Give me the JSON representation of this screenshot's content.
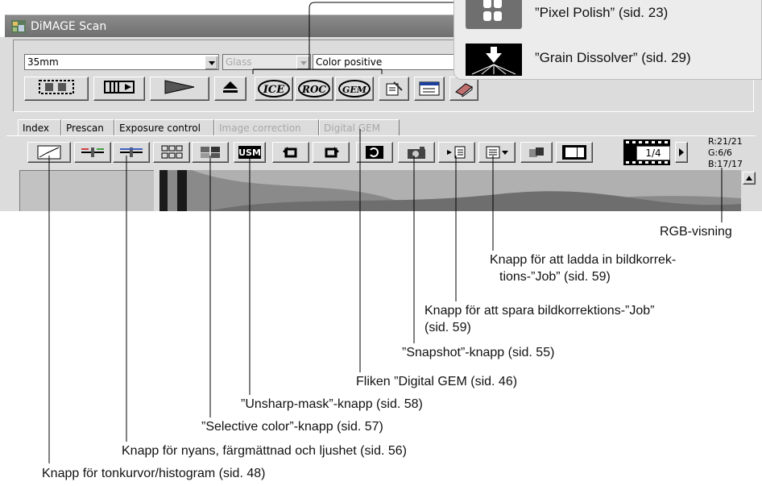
{
  "window": {
    "title": "DiMAGE Scan",
    "film_format": "35mm",
    "holder": "Glass",
    "film_type": "Color positive"
  },
  "top_toolbar": {
    "buttons": [
      "index-scan",
      "prescan",
      "scan",
      "eject",
      "ice",
      "roc",
      "gem",
      "preferences",
      "settings",
      "help"
    ],
    "ice_label": "ICE",
    "roc_label": "ROC",
    "gem_label": "GEM"
  },
  "tabs": [
    {
      "label": "Index",
      "enabled": true
    },
    {
      "label": "Prescan",
      "enabled": true
    },
    {
      "label": "Exposure control",
      "enabled": true
    },
    {
      "label": "Image correction",
      "enabled": false
    },
    {
      "label": "Digital GEM",
      "enabled": false
    }
  ],
  "correction_toolbar": {
    "frame_counter": "1/4",
    "rgb_r": "R:21/21",
    "rgb_g": "G:6/6",
    "rgb_b": "B:17/17"
  },
  "callout": {
    "pixel_polish": "”Pixel Polish” (sid. 23)",
    "grain_dissolver": "”Grain Dissolver” (sid. 29)"
  },
  "annotations": {
    "rgb_display": "RGB-visning",
    "load_job_line1": "Knapp för att ladda in bildkorrek-",
    "load_job_line2": "tions-”Job” (sid. 59)",
    "save_job_line1": "Knapp för att spara bildkorrektions-”Job”",
    "save_job_line2": "(sid. 59)",
    "snapshot": "”Snapshot”-knapp (sid. 55)",
    "digital_gem_tab": "Fliken ”Digital GEM (sid. 46)",
    "unsharp_mask": "”Unsharp-mask”-knapp (sid. 58)",
    "selective_color": "”Selective color”-knapp (sid. 57)",
    "hue_saturation": "Knapp för nyans, färgmättnad och ljushet (sid. 56)",
    "tone_curve": "Knapp för tonkurvor/histogram (sid. 48)"
  },
  "colors": {
    "window_bg": "#dcdcdc",
    "titlebar": "#7a7a7a",
    "callout_bg": "#ececec"
  }
}
